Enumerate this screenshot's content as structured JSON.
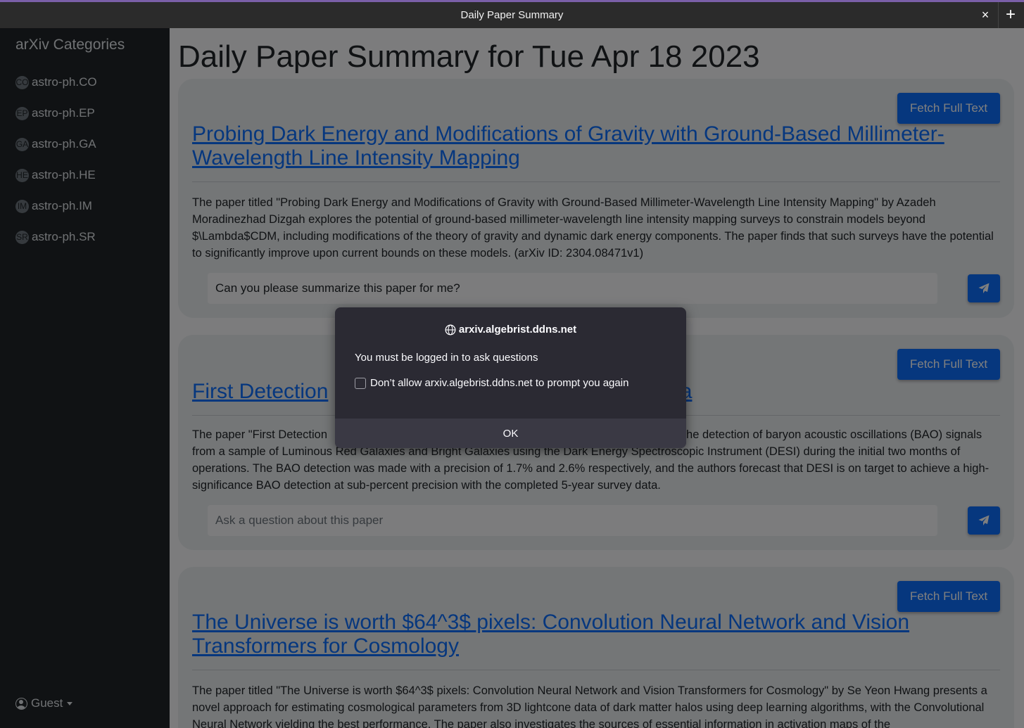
{
  "window": {
    "title": "Daily Paper Summary",
    "close_label": "×",
    "new_tab_label": "+"
  },
  "sidebar": {
    "heading": "arXiv Categories",
    "items": [
      {
        "badge": "CO",
        "label": "astro-ph.CO"
      },
      {
        "badge": "EP",
        "label": "astro-ph.EP"
      },
      {
        "badge": "GA",
        "label": "astro-ph.GA"
      },
      {
        "badge": "HE",
        "label": "astro-ph.HE"
      },
      {
        "badge": "IM",
        "label": "astro-ph.IM"
      },
      {
        "badge": "SR",
        "label": "astro-ph.SR"
      }
    ],
    "user": "Guest"
  },
  "main": {
    "page_title": "Daily Paper Summary for Tue Apr 18 2023",
    "papers": [
      {
        "fetch_label": "Fetch Full Text",
        "title": "Probing Dark Energy and Modifications of Gravity with Ground-Based Millimeter-Wavelength Line Intensity Mapping",
        "summary": "The paper titled \"Probing Dark Energy and Modifications of Gravity with Ground-Based Millimeter-Wavelength Line Intensity Mapping\" by Azadeh Moradinezhad Dizgah explores the potential of ground-based millimeter-wavelength line intensity mapping surveys to constrain models beyond $\\Lambda$CDM, including modifications of the theory of gravity and dynamic dark energy components. The paper finds that such surveys have the potential to significantly improve upon current bounds on these models. (arXiv ID: 2304.08471v1)",
        "question_value": "Can you please summarize this paper for me?",
        "question_placeholder": "Ask a question about this paper"
      },
      {
        "fetch_label": "Fetch Full Text",
        "title_left": "First Detection",
        "title_right": "ta",
        "summary_line1_left": "The paper \"First Detection",
        "summary_line1_right": "he detection of baryon acoustic oscillations (BAO) signals",
        "summary_rest": "from a sample of Luminous Red Galaxies and Bright Galaxies using the Dark Energy Spectroscopic Instrument (DESI) during the initial two months of operations. The BAO detection was made with a precision of 1.7% and 2.6% respectively, and the authors forecast that DESI is on target to achieve a high-significance BAO detection at sub-percent precision with the completed 5-year survey data.",
        "question_value": "",
        "question_placeholder": "Ask a question about this paper"
      },
      {
        "fetch_label": "Fetch Full Text",
        "title": "The Universe is worth $64^3$ pixels: Convolution Neural Network and Vision Transformers for Cosmology",
        "summary": "The paper titled \"The Universe is worth $64^3$ pixels: Convolution Neural Network and Vision Transformers for Cosmology\" by Se Yeon Hwang presents a novel approach for estimating cosmological parameters from 3D lightcone data of dark matter halos using deep learning algorithms, with the Convolutional Neural Network yielding the best performance. The paper also investigates the sources of essential information in activation maps of the"
      }
    ]
  },
  "dialog": {
    "origin": "arxiv.algebrist.ddns.net",
    "message": "You must be logged in to ask questions",
    "checkbox_label": "Don’t allow arxiv.algebrist.ddns.net to prompt you again",
    "ok_label": "OK"
  },
  "colors": {
    "accent": "#0d6efd",
    "sidebar_bg": "#212529",
    "dialog_bg": "#2b2a33"
  }
}
